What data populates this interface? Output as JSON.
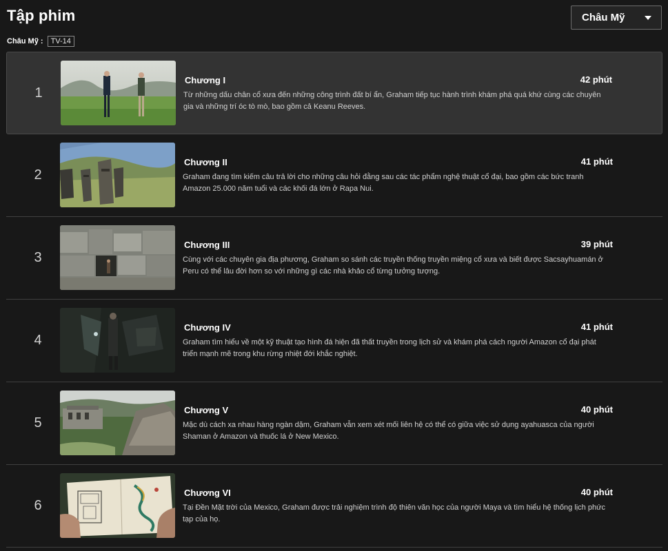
{
  "header": {
    "title": "Tập phim",
    "region_select": {
      "selected": "Châu Mỹ"
    }
  },
  "rating": {
    "label": "Châu Mỹ :",
    "badge": "TV-14"
  },
  "episodes": [
    {
      "index": "1",
      "title": "Chương I",
      "duration": "42 phút",
      "description": "Từ những dấu chân cổ xưa đến những công trình đất bí ẩn, Graham tiếp tục hành trình khám phá quá khứ cùng các chuyên gia và những trí óc tò mò, bao gồm cả Keanu Reeves."
    },
    {
      "index": "2",
      "title": "Chương II",
      "duration": "41 phút",
      "description": "Graham đang tìm kiếm câu trả lời cho những câu hỏi đằng sau các tác phẩm nghệ thuật cổ đại, bao gồm các bức tranh Amazon 25.000 năm tuổi và các khối đá lớn ở Rapa Nui."
    },
    {
      "index": "3",
      "title": "Chương III",
      "duration": "39 phút",
      "description": "Cùng với các chuyên gia địa phương, Graham so sánh các truyền thống truyền miệng cổ xưa và biết được Sacsayhuamán ở Peru có thể lâu đời hơn so với những gì các nhà khảo cổ từng tưởng tượng."
    },
    {
      "index": "4",
      "title": "Chương IV",
      "duration": "41 phút",
      "description": "Graham tìm hiểu về một kỹ thuật tạo hình đá hiện đã thất truyền trong lịch sử và khám phá cách người Amazon cổ đại phát triển mạnh mẽ trong khu rừng nhiệt đới khắc nghiệt."
    },
    {
      "index": "5",
      "title": "Chương V",
      "duration": "40 phút",
      "description": "Mặc dù cách xa nhau hàng ngàn dặm, Graham vẫn xem xét mối liên hệ có thể có giữa việc sử dụng ayahuasca của người Shaman ở Amazon và thuốc lá ở New Mexico."
    },
    {
      "index": "6",
      "title": "Chương VI",
      "duration": "40 phút",
      "description": "Tại Đền Mặt trời của Mexico, Graham được trải nghiệm trình độ thiên văn học của người Maya và tìm hiểu hệ thống lịch phức tạp của họ."
    }
  ]
}
